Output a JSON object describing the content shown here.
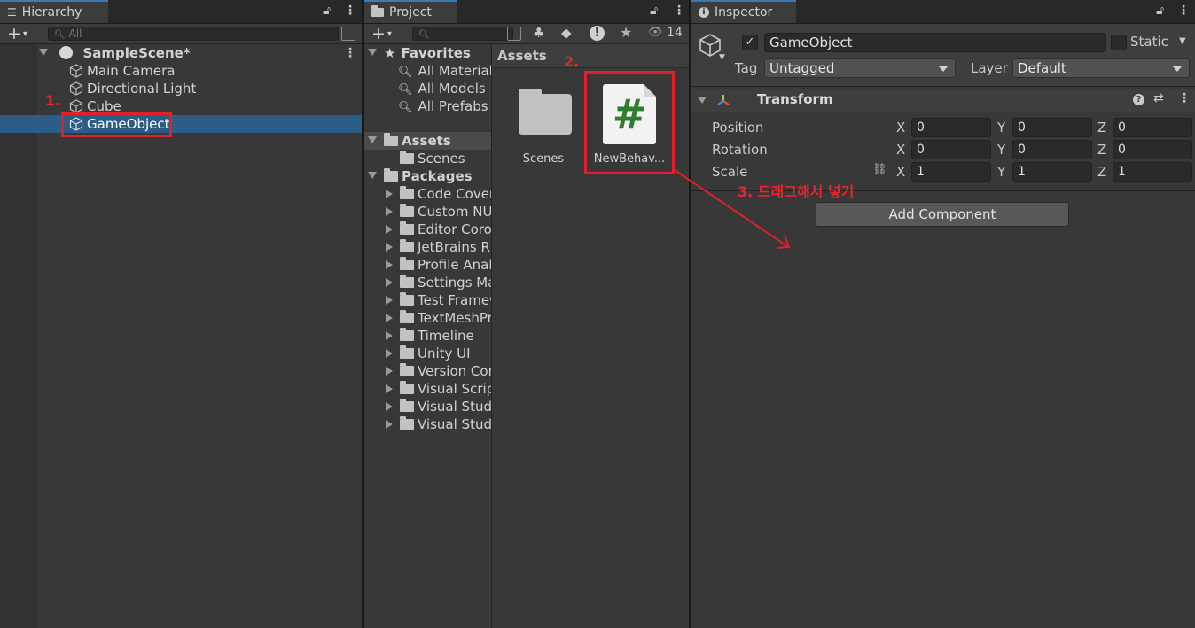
{
  "hierarchy": {
    "tab": "Hierarchy",
    "search_placeholder": "All",
    "scene": "SampleScene*",
    "items": [
      {
        "label": "Main Camera"
      },
      {
        "label": "Directional Light"
      },
      {
        "label": "Cube"
      },
      {
        "label": "GameObject"
      }
    ]
  },
  "project": {
    "tab": "Project",
    "hidden_count": "14",
    "favorites": {
      "label": "Favorites",
      "items": [
        "All Materials",
        "All Models",
        "All Prefabs"
      ]
    },
    "assets_tree": {
      "label": "Assets",
      "items": [
        "Scenes"
      ]
    },
    "packages": {
      "label": "Packages",
      "items": [
        "Code Coverage",
        "Custom NUnit",
        "Editor Coroutines",
        "JetBrains Rider",
        "Profile Analyzer",
        "Settings Manager",
        "Test Framework",
        "TextMeshPro",
        "Timeline",
        "Unity UI",
        "Version Control",
        "Visual Scripting",
        "Visual Studio",
        "Visual Studio"
      ]
    },
    "grid_title": "Assets",
    "grid_items": [
      {
        "label": "Scenes",
        "icon": "folder-icon"
      },
      {
        "label": "NewBehav...",
        "icon": "csharp-script-icon"
      }
    ]
  },
  "inspector": {
    "tab": "Inspector",
    "object_name": "GameObject",
    "static_label": "Static",
    "tag_label": "Tag",
    "tag_value": "Untagged",
    "layer_label": "Layer",
    "layer_value": "Default",
    "component": "Transform",
    "rows": [
      {
        "label": "Position",
        "x": "0",
        "y": "0",
        "z": "0"
      },
      {
        "label": "Rotation",
        "x": "0",
        "y": "0",
        "z": "0"
      },
      {
        "label": "Scale",
        "x": "1",
        "y": "1",
        "z": "1"
      }
    ],
    "axis": {
      "x": "X",
      "y": "Y",
      "z": "Z"
    },
    "add_component": "Add Component"
  },
  "annotations": {
    "step1": "1.",
    "step2": "2.",
    "step3": "3. 드래그해서 넣기",
    "color": "#e0202a"
  }
}
